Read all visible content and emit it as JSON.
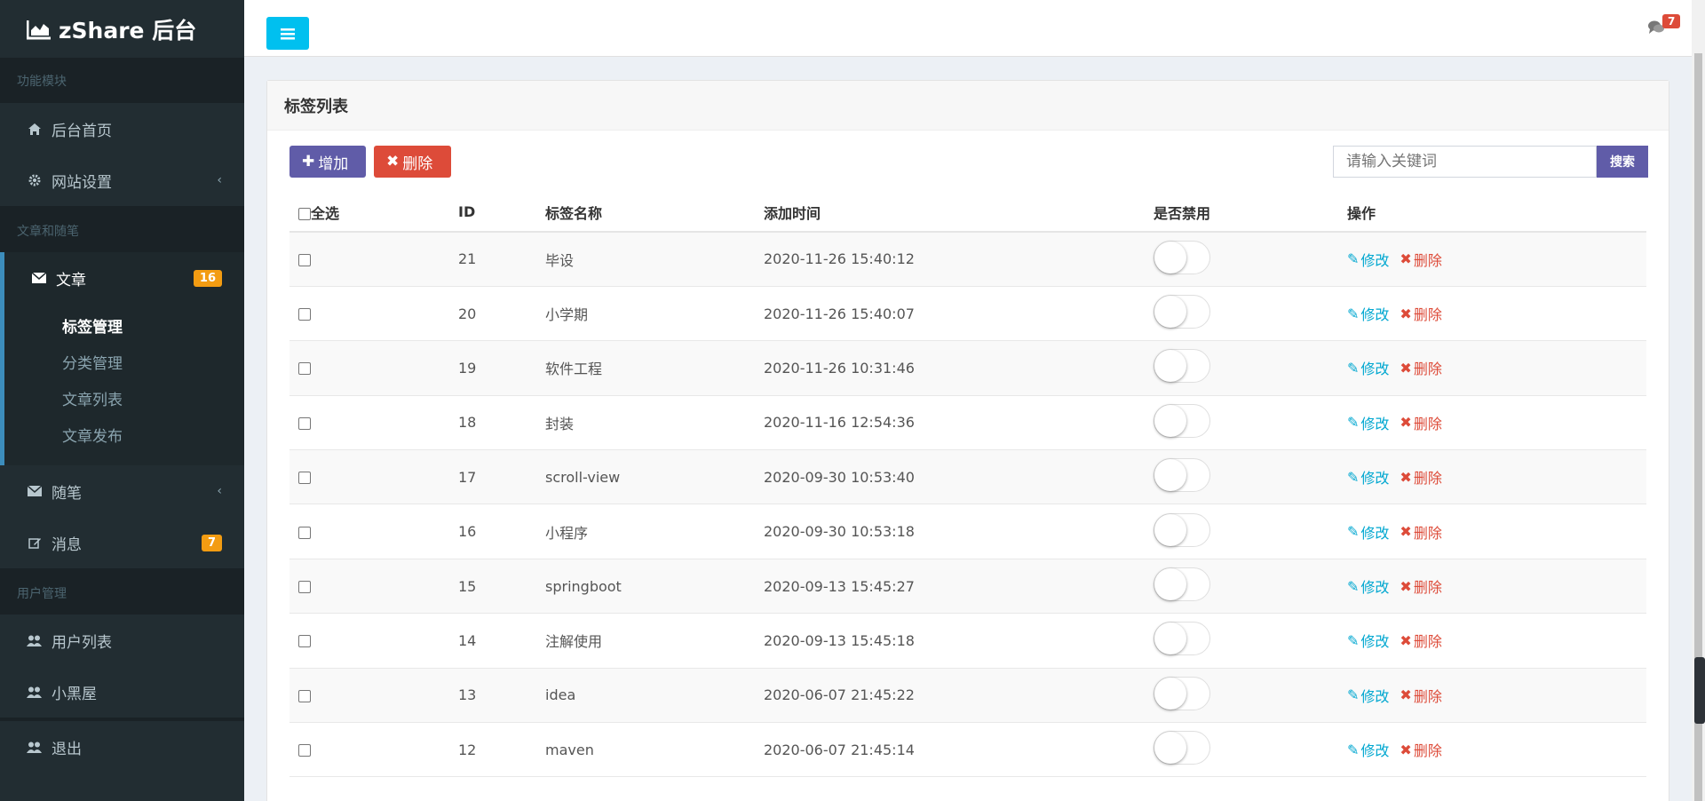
{
  "app": {
    "brand": "zShare 后台"
  },
  "sidebar": {
    "sections": [
      {
        "header": "功能模块"
      },
      {
        "header": "文章和随笔"
      },
      {
        "header": "用户管理"
      }
    ],
    "items": {
      "home": "后台首页",
      "settings": "网站设置",
      "article": "文章",
      "article_badge": "16",
      "essay": "随笔",
      "message": "消息",
      "message_badge": "7",
      "user_list": "用户列表",
      "blackroom": "小黑屋",
      "logout": "退出"
    },
    "submenu": [
      "标签管理",
      "分类管理",
      "文章列表",
      "文章发布"
    ]
  },
  "topbar": {
    "message_count": "7"
  },
  "box": {
    "title": "标签列表",
    "add_label": "增加",
    "delete_label": "删除",
    "search_placeholder": "请输入关键词",
    "search_button": "搜索"
  },
  "table": {
    "headers": {
      "select_all": "全选",
      "id": "ID",
      "name": "标签名称",
      "time": "添加时间",
      "disabled": "是否禁用",
      "ops": "操作"
    },
    "edit_label": "修改",
    "delete_label": "删除",
    "rows": [
      {
        "id": "21",
        "name": "毕设",
        "time": "2020-11-26 15:40:12"
      },
      {
        "id": "20",
        "name": "小学期",
        "time": "2020-11-26 15:40:07"
      },
      {
        "id": "19",
        "name": "软件工程",
        "time": "2020-11-26 10:31:46"
      },
      {
        "id": "18",
        "name": "封装",
        "time": "2020-11-16 12:54:36"
      },
      {
        "id": "17",
        "name": "scroll-view",
        "time": "2020-09-30 10:53:40"
      },
      {
        "id": "16",
        "name": "小程序",
        "time": "2020-09-30 10:53:18"
      },
      {
        "id": "15",
        "name": "springboot",
        "time": "2020-09-13 15:45:27"
      },
      {
        "id": "14",
        "name": "注解使用",
        "time": "2020-09-13 15:45:18"
      },
      {
        "id": "13",
        "name": "idea",
        "time": "2020-06-07 21:45:22"
      },
      {
        "id": "12",
        "name": "maven",
        "time": "2020-06-07 21:45:14"
      }
    ]
  },
  "colors": {
    "sidebar_bg": "#222d32",
    "accent_blue": "#3c8dbc",
    "toggle_btn": "#00c0ef",
    "purple": "#605ca8",
    "red": "#dd4b39",
    "badge_orange": "#f39c12",
    "link_blue": "#00a7d0"
  }
}
